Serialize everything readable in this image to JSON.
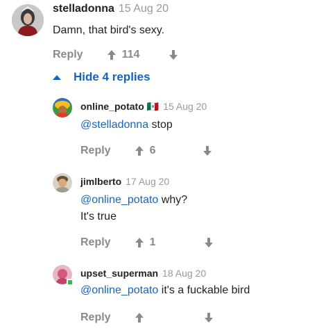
{
  "top_comment": {
    "username": "stelladonna",
    "date": "15 Aug 20",
    "text": "Damn, that bird's sexy.",
    "reply_label": "Reply",
    "votes": "114"
  },
  "hide_replies": {
    "label": "Hide 4 replies"
  },
  "replies": [
    {
      "username": "online_potato",
      "flag": "🇲🇽",
      "date": "15 Aug 20",
      "mention": "@stelladonna",
      "text": " stop",
      "reply_label": "Reply",
      "votes": "6"
    },
    {
      "username": "jimlberto",
      "date": "17 Aug 20",
      "mention": "@online_potato",
      "text": " why?",
      "text2": "It's true",
      "reply_label": "Reply",
      "votes": "1"
    },
    {
      "username": "upset_superman",
      "date": "18 Aug 20",
      "mention": "@online_potato",
      "text": " it's a fuckable bird",
      "reply_label": "Reply",
      "votes": ""
    }
  ],
  "colors": {
    "link": "#1565c0",
    "muted": "#8a8a8a",
    "online": "#3bb54a"
  }
}
